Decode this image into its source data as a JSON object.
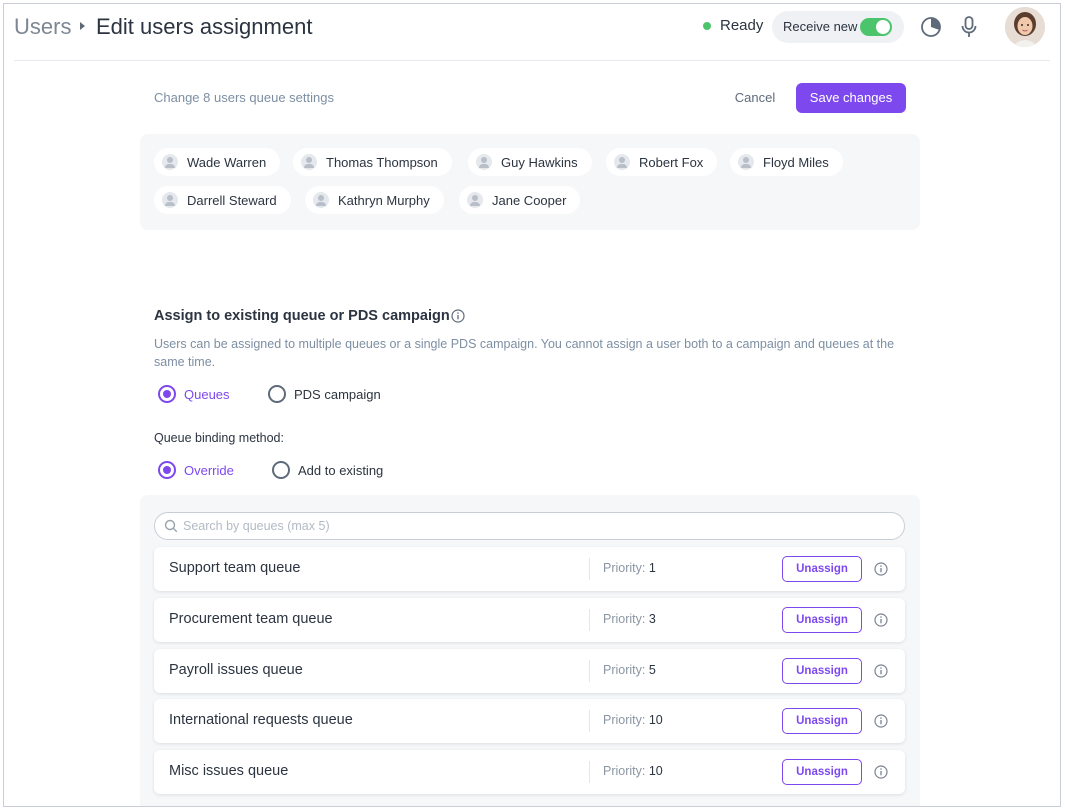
{
  "header": {
    "breadcrumb_root": "Users",
    "title": "Edit users assignment",
    "status": "Ready",
    "receive_label": "Receive new",
    "receive_enabled": true
  },
  "colors": {
    "accent": "#7d49ef",
    "status_green": "#4cc46b",
    "muted_text": "#7d8fa3"
  },
  "top": {
    "subtitle": "Change 8 users queue settings",
    "cancel_label": "Cancel",
    "save_label": "Save changes"
  },
  "users": [
    "Wade Warren",
    "Thomas Thompson",
    "Guy Hawkins",
    "Robert Fox",
    "Floyd Miles",
    "Darrell Steward",
    "Kathryn Murphy",
    "Jane Cooper"
  ],
  "assign": {
    "title": "Assign to existing queue or PDS campaign",
    "description": "Users can be assigned to multiple queues or a single PDS campaign. You cannot assign a user both to a campaign and queues at the same time.",
    "type_options": [
      {
        "label": "Queues",
        "selected": true
      },
      {
        "label": "PDS campaign",
        "selected": false
      }
    ],
    "binding_label": "Queue binding method:",
    "binding_options": [
      {
        "label": "Override",
        "selected": true
      },
      {
        "label": "Add to existing",
        "selected": false
      }
    ]
  },
  "search": {
    "placeholder": "Search by queues (max 5)",
    "value": ""
  },
  "queues": [
    {
      "name": "Support team queue",
      "priority_label": "Priority:",
      "priority": "1",
      "action": "Unassign"
    },
    {
      "name": "Procurement team queue",
      "priority_label": "Priority:",
      "priority": "3",
      "action": "Unassign"
    },
    {
      "name": "Payroll issues queue",
      "priority_label": "Priority:",
      "priority": "5",
      "action": "Unassign"
    },
    {
      "name": "International requests queue",
      "priority_label": "Priority:",
      "priority": "10",
      "action": "Unassign"
    },
    {
      "name": "Misc issues queue",
      "priority_label": "Priority:",
      "priority": "10",
      "action": "Unassign"
    }
  ],
  "icons": {
    "status": "status-dot-icon",
    "analytics": "pie-chart-icon",
    "microphone": "microphone-icon",
    "user": "user-icon",
    "info": "info-icon",
    "search": "search-icon"
  }
}
